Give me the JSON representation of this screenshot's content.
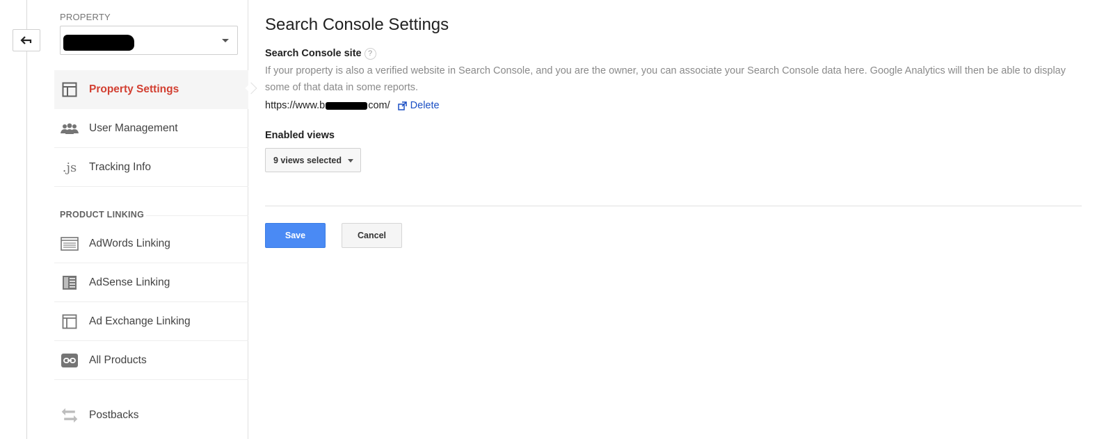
{
  "sidebar": {
    "property_label": "PROPERTY",
    "property_value": "",
    "items": [
      {
        "label": "Property Settings",
        "icon": "layout-icon",
        "active": true
      },
      {
        "label": "User Management",
        "icon": "users-icon"
      },
      {
        "label": "Tracking Info",
        "icon": "js-icon",
        "icon_text": ".js"
      }
    ],
    "product_linking_header": "PRODUCT LINKING",
    "linking_items": [
      {
        "label": "AdWords Linking",
        "icon": "adwords-icon"
      },
      {
        "label": "AdSense Linking",
        "icon": "adsense-icon"
      },
      {
        "label": "Ad Exchange Linking",
        "icon": "ad-exchange-icon"
      },
      {
        "label": "All Products",
        "icon": "link-icon"
      }
    ],
    "postbacks": {
      "label": "Postbacks",
      "icon": "postbacks-icon"
    }
  },
  "main": {
    "title": "Search Console Settings",
    "search_console_site_label": "Search Console site",
    "help_glyph": "?",
    "description": "If your property is also a verified website in Search Console, and you are the owner, you can associate your Search Console data here. Google Analytics will then be able to display some of that data in some reports.",
    "site_url_prefix": "https://www.b",
    "site_url_suffix": "com/",
    "delete_label": "Delete",
    "enabled_views_label": "Enabled views",
    "views_selected": "9 views selected",
    "save_label": "Save",
    "cancel_label": "Cancel"
  },
  "colors": {
    "active_nav": "#d23f31",
    "primary_button": "#4a8af4",
    "link": "#1a4fc4"
  }
}
